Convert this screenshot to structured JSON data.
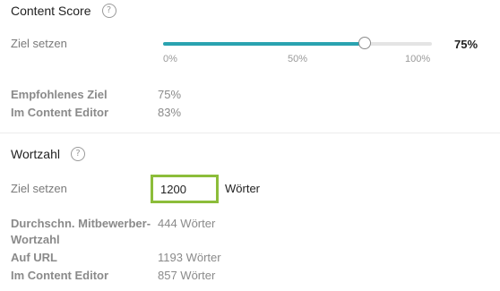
{
  "content_score": {
    "title": "Content Score",
    "help_icon": "?",
    "target_label": "Ziel setzen",
    "slider": {
      "value_label": "75%",
      "fraction": 0.75,
      "ticks": [
        "0%",
        "50%",
        "100%"
      ],
      "fill_color": "#2aa3b0"
    },
    "recommended_label": "Empfohlenes Ziel",
    "recommended_value": "75%",
    "editor_label": "Im Content Editor",
    "editor_value": "83%"
  },
  "word_count": {
    "title": "Wortzahl",
    "help_icon": "?",
    "target_label": "Ziel setzen",
    "input_value": "1200",
    "input_unit": "Wörter",
    "input_border_color": "#8cbd3a",
    "competitor_label_line1": "Durchschn. Mitbewerber-",
    "competitor_label_line2": "Wortzahl",
    "competitor_value": "444 Wörter",
    "url_label": "Auf URL",
    "url_value": "1193 Wörter",
    "editor_label": "Im Content Editor",
    "editor_value": "857 Wörter"
  }
}
